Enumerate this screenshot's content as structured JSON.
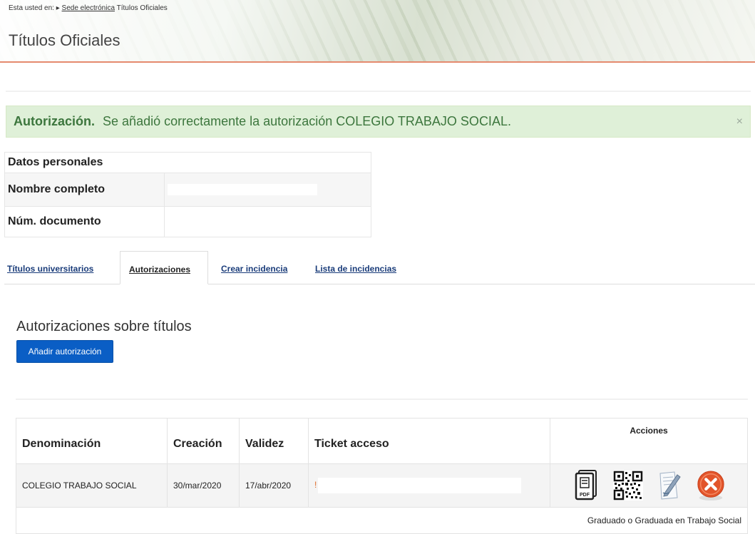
{
  "header": {
    "breadcrumb_prefix": "Esta usted en:",
    "breadcrumb_link": "Sede electrónica",
    "breadcrumb_current": "Títulos Oficiales",
    "title": "Títulos Oficiales"
  },
  "alert": {
    "title": "Autorización.",
    "message": "Se añadió correctamente la autorización COLEGIO TRABAJO SOCIAL.",
    "close": "×",
    "color": "#dff0d8"
  },
  "personal": {
    "heading": "Datos personales",
    "name_label": "Nombre completo",
    "doc_label": "Núm. documento"
  },
  "tabs": [
    {
      "label": "Títulos universitarios"
    },
    {
      "label": "Autorizaciones",
      "active": true
    },
    {
      "label": "Crear incidencia"
    },
    {
      "label": "Lista de incidencias"
    }
  ],
  "section": {
    "title": "Autorizaciones sobre títulos",
    "add_button": "Añadir autorización",
    "button_color": "#0a5ec5"
  },
  "table": {
    "headers": {
      "denominacion": "Denominación",
      "creacion": "Creación",
      "validez": "Validez",
      "ticket": "Ticket acceso",
      "acciones": "Acciones"
    },
    "row": {
      "denominacion": "COLEGIO TRABAJO SOCIAL",
      "creacion": "30/mar/2020",
      "validez": "17/abr/2020",
      "ticket_mark": "!",
      "actions": [
        "pdf-icon",
        "qr-code-icon",
        "edit-icon",
        "delete-icon"
      ]
    },
    "subrow": "Graduado o Graduada en Trabajo Social"
  }
}
